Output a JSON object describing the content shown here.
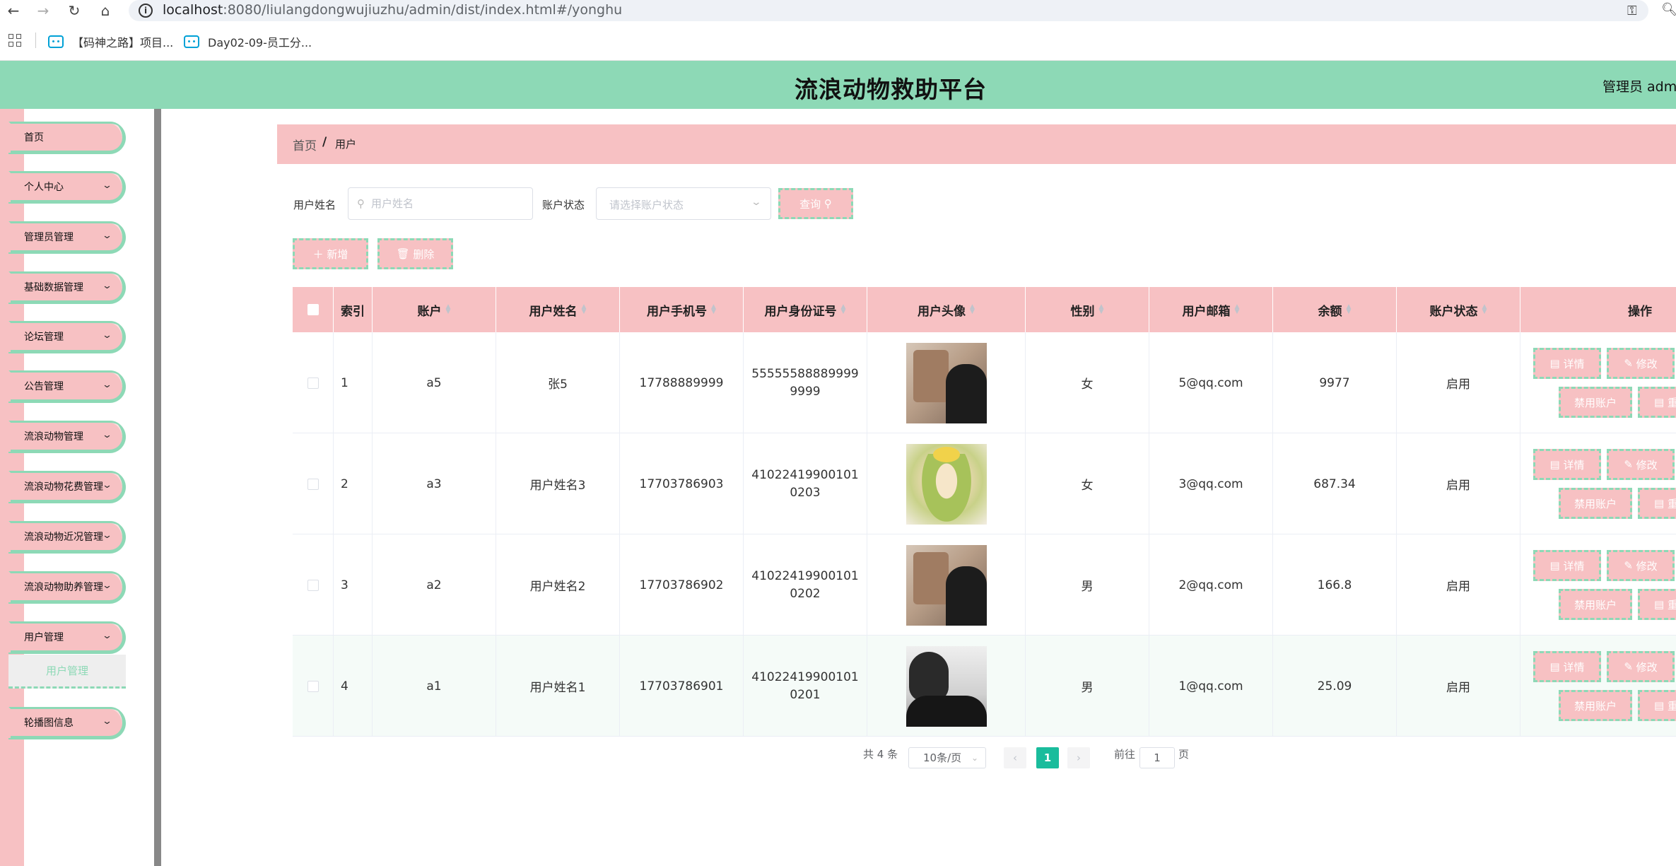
{
  "browser": {
    "url_host": "localhost",
    "url_rest": ":8080/liulangdongwujiuzhu/admin/dist/index.html#/yonghu",
    "bookmarks": [
      "【码神之路】项目...",
      "Day02-09-员工分..."
    ]
  },
  "header": {
    "title": "流浪动物救助平台",
    "admin": "管理员 admi"
  },
  "sidebar": {
    "items": [
      {
        "label": "首页",
        "chevron": false
      },
      {
        "label": "个人中心",
        "chevron": true
      },
      {
        "label": "管理员管理",
        "chevron": true
      },
      {
        "label": "基础数据管理",
        "chevron": true
      },
      {
        "label": "论坛管理",
        "chevron": true
      },
      {
        "label": "公告管理",
        "chevron": true
      },
      {
        "label": "流浪动物管理",
        "chevron": true
      },
      {
        "label": "流浪动物花费管理",
        "chevron": true
      },
      {
        "label": "流浪动物近况管理",
        "chevron": true
      },
      {
        "label": "流浪动物助养管理",
        "chevron": true
      },
      {
        "label": "用户管理",
        "chevron": true
      },
      {
        "label": "轮播图信息",
        "chevron": true
      }
    ],
    "sub_item": "用户管理"
  },
  "breadcrumb": {
    "home": "首页",
    "sep": "/",
    "current": "用户"
  },
  "search": {
    "name_label": "用户姓名",
    "name_placeholder": "用户姓名",
    "status_label": "账户状态",
    "status_placeholder": "请选择账户状态",
    "query_button": "查询"
  },
  "toolbar": {
    "add_button": "新增",
    "delete_button": "删除"
  },
  "table": {
    "columns": [
      "索引",
      "账户",
      "用户姓名",
      "用户手机号",
      "用户身份证号",
      "用户头像",
      "性别",
      "用户邮箱",
      "余额",
      "账户状态",
      "操作"
    ],
    "rows": [
      {
        "index": "1",
        "account": "a5",
        "name": "张5",
        "phone": "17788889999",
        "id_card": "555555888899999999",
        "gender": "女",
        "email": "5@qq.com",
        "balance": "9977",
        "status": "启用",
        "avatar": "av-a"
      },
      {
        "index": "2",
        "account": "a3",
        "name": "用户姓名3",
        "phone": "17703786903",
        "id_card": "410224199001010203",
        "gender": "女",
        "email": "3@qq.com",
        "balance": "687.34",
        "status": "启用",
        "avatar": "av-b"
      },
      {
        "index": "3",
        "account": "a2",
        "name": "用户姓名2",
        "phone": "17703786902",
        "id_card": "410224199001010202",
        "gender": "男",
        "email": "2@qq.com",
        "balance": "166.8",
        "status": "启用",
        "avatar": "av-a"
      },
      {
        "index": "4",
        "account": "a1",
        "name": "用户姓名1",
        "phone": "17703786901",
        "id_card": "410224199001010201",
        "gender": "男",
        "email": "1@qq.com",
        "balance": "25.09",
        "status": "启用",
        "avatar": "av-c"
      }
    ],
    "actions": {
      "detail": "详情",
      "edit": "修改",
      "disable": "禁用账户",
      "reset": "重"
    }
  },
  "pagination": {
    "total": "共 4 条",
    "page_size": "10条/页",
    "current_page": "1",
    "goto_label": "前往",
    "goto_value": "1",
    "page_unit": "页"
  },
  "colors": {
    "header_green": "#8dd9b6",
    "accent_pink": "#f7c1c3",
    "page_active": "#1abc9c"
  }
}
